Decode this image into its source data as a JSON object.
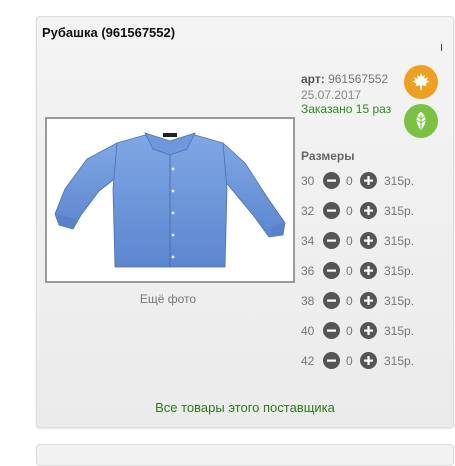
{
  "product": {
    "title": "Рубашка (961567552)",
    "art_label": "арт:",
    "art_value": "961567552",
    "date": "25.07.2017",
    "ordered": "Заказано 15 раз",
    "more_photo": "Ещё фото",
    "image_alt": "blue shirt photo"
  },
  "badges": [
    {
      "icon": "maple-leaf-icon",
      "color": "#f0a020"
    },
    {
      "icon": "leaf-icon",
      "color": "#7cc242"
    }
  ],
  "sizes": {
    "heading": "Размеры",
    "rows": [
      {
        "size": "30",
        "qty": "0",
        "price": "315р."
      },
      {
        "size": "32",
        "qty": "0",
        "price": "315р."
      },
      {
        "size": "34",
        "qty": "0",
        "price": "315р."
      },
      {
        "size": "36",
        "qty": "0",
        "price": "315р."
      },
      {
        "size": "38",
        "qty": "0",
        "price": "315р."
      },
      {
        "size": "40",
        "qty": "0",
        "price": "315р."
      },
      {
        "size": "42",
        "qty": "0",
        "price": "315р."
      }
    ]
  },
  "supplier_link": "Все товары этого поставщика",
  "colors": {
    "link_green": "#2d7d1a",
    "ordered_green": "#2d8a1f",
    "button_dark": "#555555"
  }
}
